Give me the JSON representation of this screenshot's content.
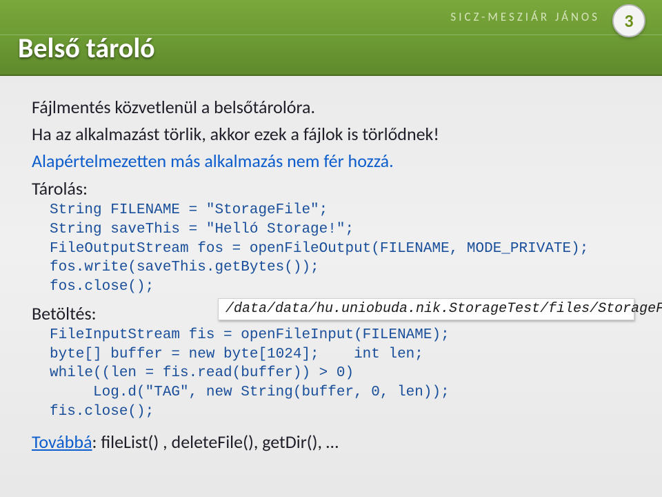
{
  "header": {
    "author": "SICZ-MESZIÁR JÁNOS",
    "page_number": "3",
    "title": "Belső tároló"
  },
  "lines": {
    "l1": "Fájlmentés közvetlenül a belsőtárolóra.",
    "l2": "Ha az alkalmazást törlik, akkor ezek a fájlok is törlődnek!",
    "l3": "Alapértelmezetten más alkalmazás nem fér hozzá."
  },
  "storage": {
    "heading": "Tárolás:",
    "code": "String FILENAME = \"StorageFile\";\nString saveThis = \"Helló Storage!\";\nFileOutputStream fos = openFileOutput(FILENAME, MODE_PRIVATE);\nfos.write(saveThis.getBytes());\nfos.close();"
  },
  "path_hint": "/data/data/hu.uniobuda.nik.StorageTest/files/StorageFile",
  "load": {
    "heading": "Betöltés:",
    "code": "FileInputStream fis = openFileInput(FILENAME);\nbyte[] buffer = new byte[1024];    int len;\nwhile((len = fis.read(buffer)) > 0)\n     Log.d(\"TAG\", new String(buffer, 0, len));\nfis.close();"
  },
  "footer": {
    "link_label": "Továbbá",
    "rest": ": fileList() , deleteFile(), getDir(), …"
  }
}
